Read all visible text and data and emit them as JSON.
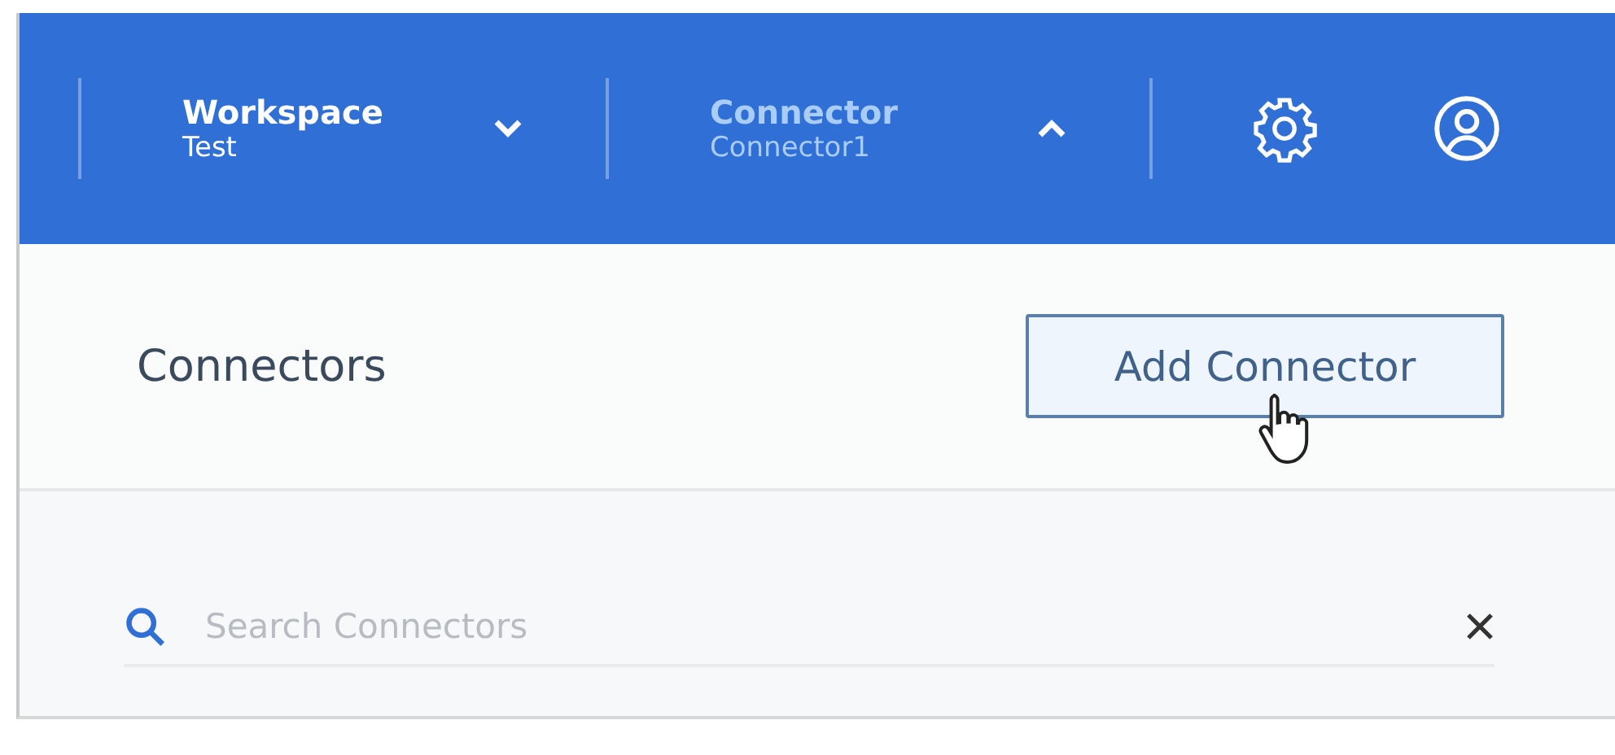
{
  "header": {
    "menus": [
      {
        "label": "Workspace",
        "value": "Test",
        "expanded": false
      },
      {
        "label": "Connector",
        "value": "Connector1",
        "expanded": true
      }
    ]
  },
  "panel": {
    "title": "Connectors",
    "add_button": "Add Connector"
  },
  "search": {
    "placeholder": "Search Connectors"
  }
}
